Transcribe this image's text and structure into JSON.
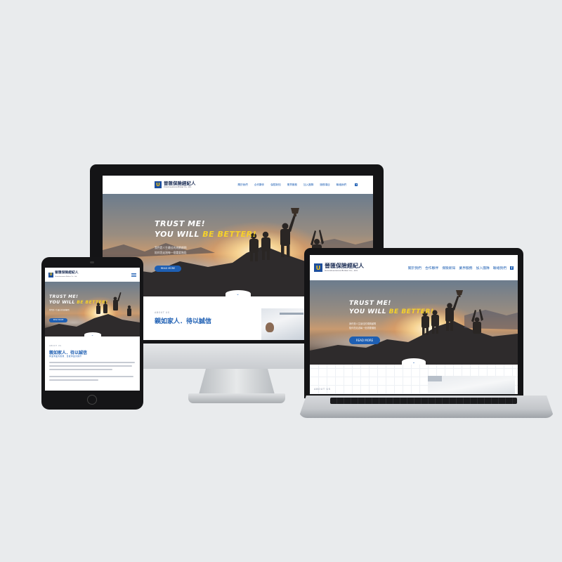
{
  "brand": {
    "name_zh": "晉匯保險經紀人",
    "name_en": "UnionInsurance Broker Co., Ltd.",
    "logo_letter": "U",
    "primary_color": "#1e5fb3",
    "accent_color": "#f6d12a"
  },
  "nav": {
    "items": [
      "關於我們",
      "合作夥伴",
      "保險新知",
      "業界服務",
      "加入團隊",
      "聯絡我們"
    ]
  },
  "desktop_nav": {
    "items": [
      "關於我們",
      "合作夥伴",
      "保險新知",
      "業界服務",
      "加入團隊",
      "服務項目",
      "聯絡我們"
    ]
  },
  "hero": {
    "line1": "TRUST ME!",
    "line2_prefix": "YOU WILL ",
    "line2_highlight": "BE BETTER!",
    "sub1": "我們是人生最佳的規劃顧問",
    "sub2": "陪伴您走過每一個重要階段",
    "button": "READ MORE",
    "scroll_icon": "chevron-down-icon"
  },
  "about": {
    "label": "ABOUT US",
    "title": "親如家人．待以誠信",
    "subtitle": "專業專業的服務．溫暖專業的夥伴",
    "para1": "一直是台灣最信任的夥伴，我們提供專業的保險規劃與全方位的理賠服務，為每一位客戶量身打造最適合的保障。",
    "para2": "與我們一起迎向更美好的未來，讓專業成為您最堅強的後盾。"
  },
  "icons": {
    "facebook": "facebook-icon",
    "menu": "hamburger-menu-icon",
    "trophy": "trophy-icon"
  }
}
